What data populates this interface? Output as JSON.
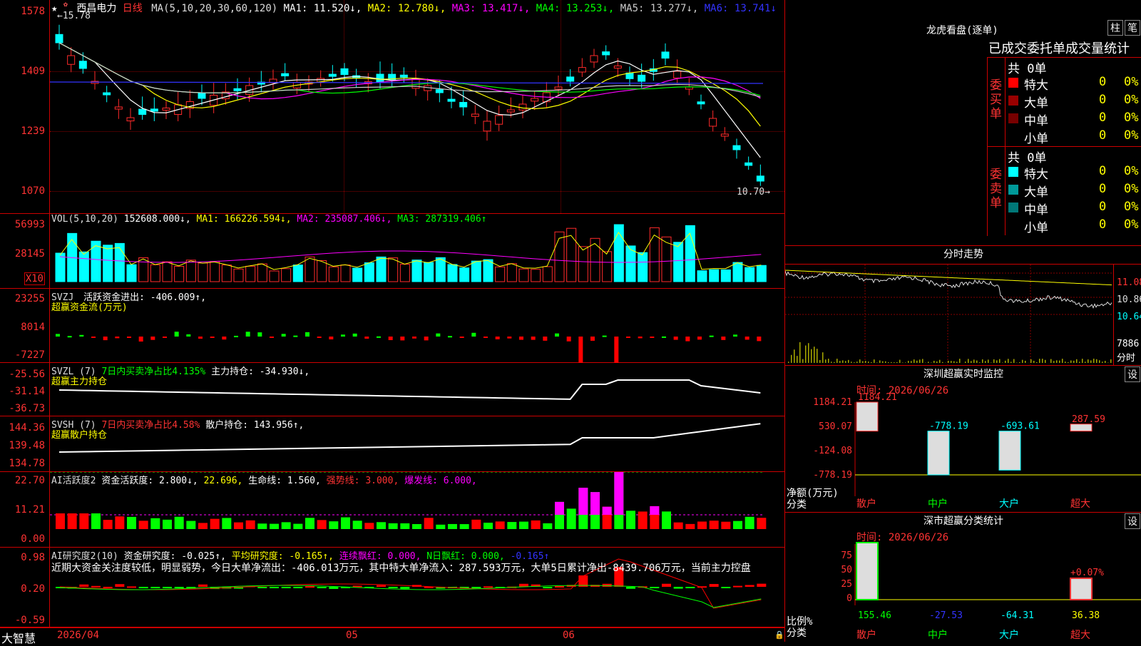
{
  "app": {
    "brand": "大智慧"
  },
  "kline": {
    "star": "★",
    "name": "西昌电力",
    "period": "日线",
    "ma_label": "MA(5,10,20,30,60,120)",
    "ma1": "MA1: 11.520↓,",
    "ma2": "MA2: 12.780↓,",
    "ma3": "MA3: 13.417↓,",
    "ma4": "MA4: 13.253↓,",
    "ma5": "MA5: 13.277↓,",
    "ma6": "MA6: 13.741↓",
    "high_mark": "15.78",
    "low_mark": "10.70",
    "ticks": [
      "1578",
      "1409",
      "1239",
      "1070"
    ]
  },
  "vol": {
    "label": "VOL(5,10,20)",
    "value": "152608.000↓,",
    "ma1": "MA1: 166226.594↓,",
    "ma2": "MA2: 235087.406↓,",
    "ma3": "MA3: 287319.406↑",
    "ticks": [
      "56993",
      "28145"
    ],
    "unit": "X10"
  },
  "svzj": {
    "label": "SVZJ",
    "l1": "活跃资金进出: -406.009↑,",
    "l2": "超赢资金流(万元)",
    "ticks": [
      "23255",
      "8014",
      "-7227"
    ]
  },
  "svzl": {
    "label": "SVZL (7)",
    "l1": "7日内买卖净占比4.135%",
    "l2": "主力持仓: -34.930↓,",
    "l3": "超赢主力持仓",
    "ticks": [
      "-25.56",
      "-31.14",
      "-36.73"
    ]
  },
  "svsh": {
    "label": "SVSH (7)",
    "l1": "7日内买卖净占比4.58%",
    "l2": "散户持仓: 143.956↑,",
    "l3": "超赢散户持仓",
    "ticks": [
      "144.36",
      "139.48",
      "134.78"
    ]
  },
  "ai1": {
    "label": "AI活跃度2",
    "l1": "资金活跃度: 2.800↓,",
    "l2": "22.696,",
    "l3": "生命线: 1.560,",
    "l4": "强势线: 3.000,",
    "l5": "爆发线: 6.000,",
    "ticks": [
      "22.70",
      "11.21",
      "0.00"
    ]
  },
  "ai2": {
    "label": "AI研究度2(10)",
    "l1": "资金研究度: -0.025↑,",
    "l2": "平均研究度: -0.165↑,",
    "l3": "连续飘红: 0.000,",
    "l4": "N日飘红: 0.000,",
    "l5": "-0.165↑",
    "comment": "近期大资金关注度较低，明显弱势，今日大单净流出：-406.013万元，其中特大单净流入：287.593万元，大单5日累计净出-8439.706万元，当前主力控盘",
    "ticks": [
      "0.98",
      "0.20",
      "-0.59"
    ]
  },
  "xaxis": {
    "d1": "2026/04",
    "d2": "05",
    "d3": "06"
  },
  "longhu": {
    "title": "龙虎看盘(逐单)",
    "btn_bar": "柱",
    "btn_pen": "笔",
    "tabs": "已成交委托单成交量统计",
    "buy_side": "委买单",
    "sell_side": "委卖单",
    "buy_total": "共 0单",
    "sell_total": "共 0单",
    "rows": [
      {
        "name": "特大",
        "v": "0",
        "p": "0%"
      },
      {
        "name": "大单",
        "v": "0",
        "p": "0%"
      },
      {
        "name": "中单",
        "v": "0",
        "p": "0%"
      },
      {
        "name": "小单",
        "v": "0",
        "p": "0%"
      }
    ],
    "colors": {
      "buy_xl": "#ff0000",
      "buy_l": "#990000",
      "buy_m": "#770000",
      "sell_xl": "#00ffff",
      "sell_l": "#009999",
      "sell_m": "#007777"
    }
  },
  "fenshi": {
    "title": "分时走势",
    "ticks": [
      "11.08",
      "10.86",
      "10.64"
    ],
    "vol_tick": "7886",
    "unit": "分时"
  },
  "sz_monitor": {
    "title": "深圳超赢实时监控",
    "btn": "设",
    "time": "时间: 2026/06/26",
    "ticks": [
      "1184.21",
      "530.07",
      "-124.08",
      "-778.19"
    ],
    "ylabel": "净额(万元)",
    "xlabel": "分类",
    "cats": [
      "散户",
      "中户",
      "大户",
      "超大"
    ],
    "values": [
      1184.21,
      -778.19,
      -693.61,
      287.59
    ],
    "value_labels": [
      "1184.21",
      "-778.19",
      "-693.61",
      "287.59"
    ]
  },
  "sz_class": {
    "title": "深市超赢分类统计",
    "btn": "设",
    "time": "时间: 2026/06/26",
    "ticks": [
      "75",
      "50",
      "25",
      "0"
    ],
    "ylabel": "比例%",
    "xlabel": "分类",
    "cats": [
      "散户",
      "中户",
      "大户",
      "超大"
    ],
    "values": [
      "155.46",
      "-27.53",
      "-64.31",
      "36.38"
    ],
    "pct": "+0.07%"
  }
}
